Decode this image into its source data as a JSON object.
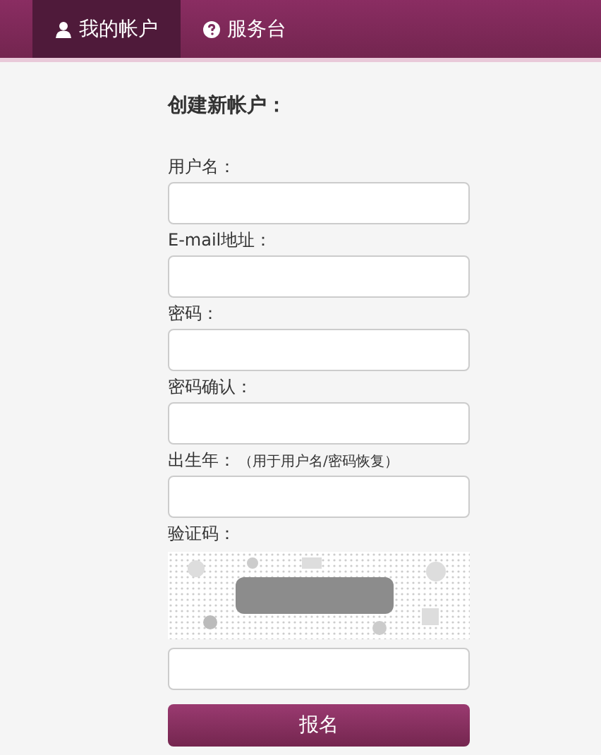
{
  "nav": {
    "tabs": [
      {
        "label": "我的帐户",
        "kind": "user",
        "selected": true
      },
      {
        "label": "服务台",
        "kind": "help",
        "selected": false
      }
    ]
  },
  "form": {
    "title": "创建新帐户：",
    "fields": [
      {
        "label": "用户名：",
        "kind": "input"
      },
      {
        "label": "E-mail地址：",
        "kind": "input"
      },
      {
        "label": "密码：",
        "kind": "input"
      },
      {
        "label": "密码确认：",
        "kind": "input"
      },
      {
        "label": "出生年：",
        "hint": "（用于用户名/密码恢复）",
        "kind": "input"
      },
      {
        "label": "验证码：",
        "kind": "captcha"
      }
    ],
    "submit": "报名"
  }
}
